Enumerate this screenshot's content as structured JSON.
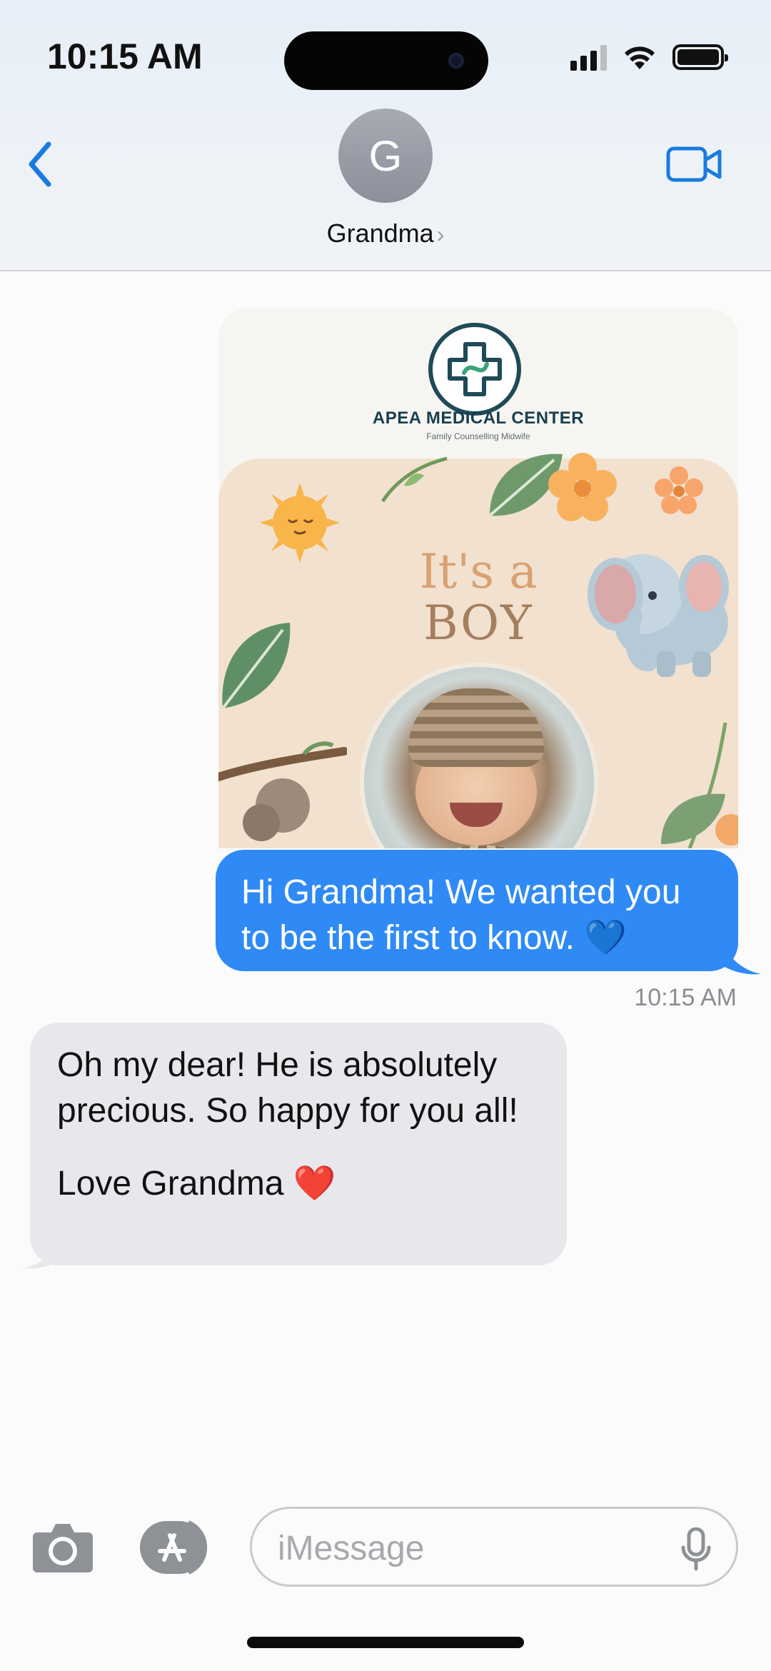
{
  "status_bar": {
    "time": "10:15 AM"
  },
  "header": {
    "avatar_initial": "G",
    "contact_name": "Grandma",
    "contact_chevron": "›"
  },
  "thread": {
    "attachment": {
      "org_title": "APEA MEDICAL CENTER",
      "org_subtitle": "Family Counselling Midwife",
      "line1": "It's a",
      "line2": "BOY"
    },
    "sent": {
      "text": "Hi Grandma! We wanted you to be the first to know. 💙",
      "time": "10:15 AM"
    },
    "received": {
      "paragraph1": "Oh my dear! He is absolutely precious. So happy for you all!",
      "paragraph2": "Love Grandma ❤️"
    }
  },
  "composer": {
    "placeholder": "iMessage"
  },
  "colors": {
    "accent_blue": "#2f8af5",
    "icon_blue": "#1a7ae0",
    "received_bubble": "#e8e8ec"
  },
  "icons": [
    "back-chevron-icon",
    "video-call-icon",
    "camera-icon",
    "app-store-icon",
    "microphone-icon"
  ]
}
